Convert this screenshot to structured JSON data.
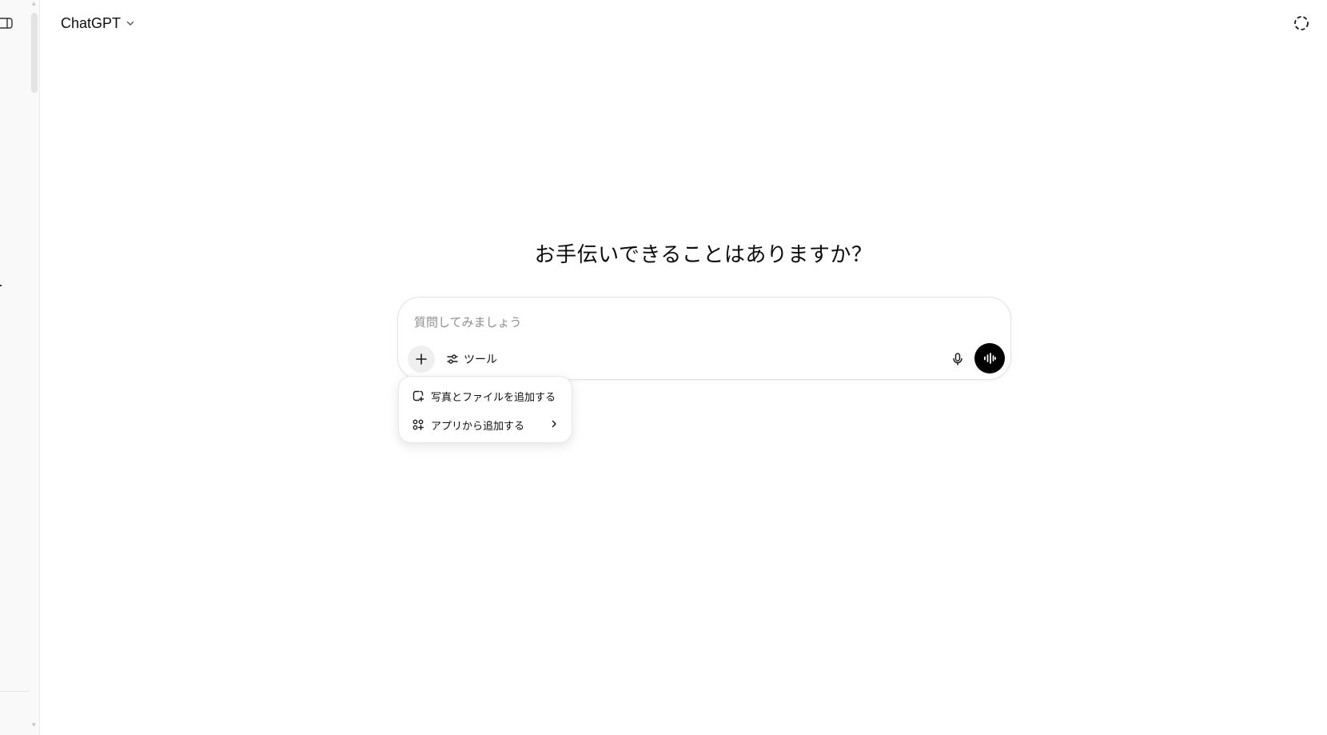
{
  "header": {
    "model_name": "ChatGPT"
  },
  "main": {
    "heading": "お手伝いできることはありますか？"
  },
  "composer": {
    "placeholder": "質問してみましょう",
    "tools_label": "ツール"
  },
  "attach_menu": {
    "items": [
      {
        "label": "写真とファイルを追加する",
        "icon": "attach-file-icon"
      },
      {
        "label": "アプリから追加する",
        "icon": "apps-grid-icon",
        "has_submenu": true
      }
    ]
  },
  "colors": {
    "voice_button_bg": "#000000",
    "plus_button_bg": "#efefef",
    "placeholder_text": "#8f8f8f"
  }
}
